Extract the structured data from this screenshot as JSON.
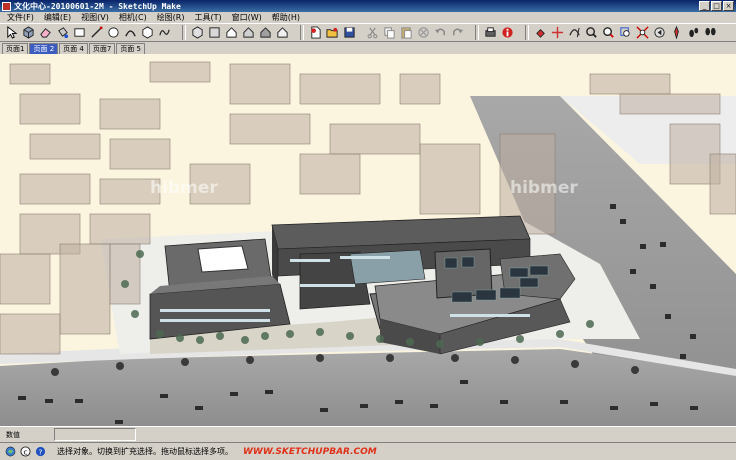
{
  "window": {
    "title": "文化中心-20100601-2M - SketchUp Make"
  },
  "menu": [
    "文件(F)",
    "编辑(E)",
    "视图(V)",
    "相机(C)",
    "绘图(R)",
    "工具(T)",
    "窗口(W)",
    "帮助(H)"
  ],
  "toolbar": {
    "icons": [
      "select-icon",
      "make-component-icon",
      "eraser-icon",
      "paint-bucket-icon",
      "rectangle-icon",
      "line-icon",
      "circle-icon",
      "arc-icon",
      "polygon-icon",
      "freehand-icon",
      "iso-view-icon",
      "top-view-icon",
      "front-view-icon",
      "right-view-icon",
      "back-view-icon",
      "left-view-icon",
      "new-file-icon",
      "open-file-icon",
      "save-icon",
      "cut-icon",
      "copy-icon",
      "paste-icon",
      "delete-icon",
      "undo-icon",
      "redo-icon",
      "print-icon",
      "model-info-icon",
      "push-pull-icon",
      "move-icon",
      "orbit-icon",
      "pan-icon",
      "zoom-icon",
      "zoom-window-icon",
      "zoom-extents-icon",
      "previous-view-icon",
      "position-camera-icon",
      "walk-icon",
      "look-around-icon"
    ]
  },
  "scenes": {
    "tabs": [
      "页面1",
      "页面 2",
      "页面 4",
      "页面7",
      "页面 5"
    ],
    "active": 1
  },
  "watermarks": [
    "hibmer",
    "hibmer"
  ],
  "value_control": {
    "label": "数值",
    "value": ""
  },
  "status": {
    "text": "选择对象。切换到扩充选择。拖动鼠标选择多项。",
    "url": "WWW.SKETCHUPBAR.COM"
  },
  "colors": {
    "title_gradient_start": "#0a246a",
    "title_gradient_end": "#3a6ea5",
    "chrome": "#d4d0c8",
    "ground": "#fbf4df",
    "road": "#9a9a9a",
    "active_tab": "#3c5cc0",
    "url": "#e03018"
  }
}
